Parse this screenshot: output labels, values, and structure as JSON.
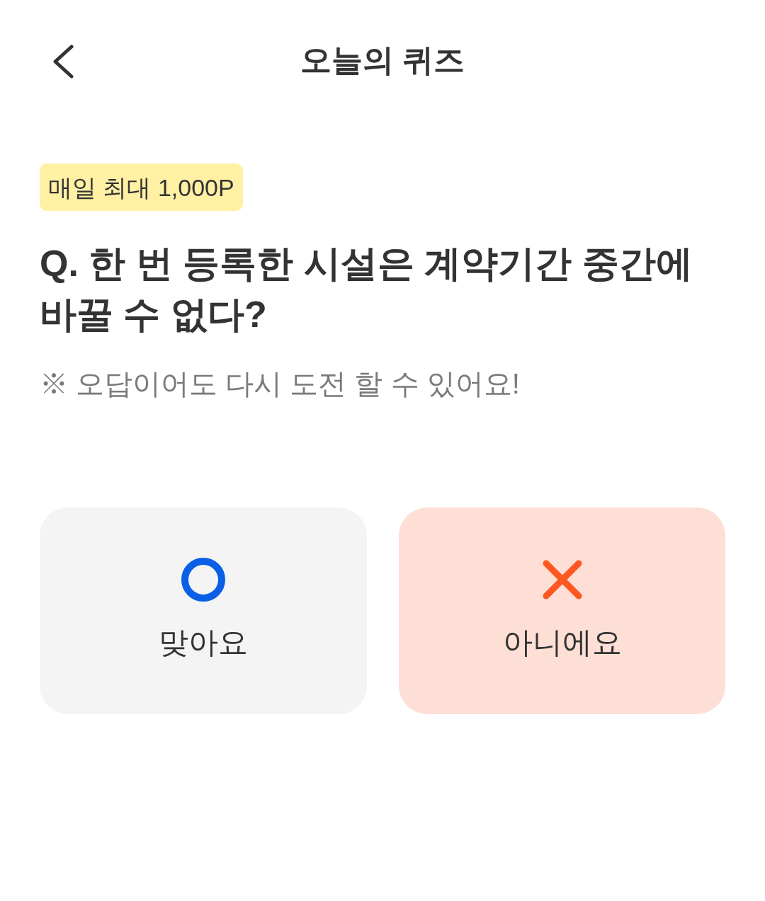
{
  "header": {
    "title": "오늘의 퀴즈"
  },
  "badge": "매일 최대 1,000P",
  "question": "Q. 한 번 등록한 시설은 계약기간 중간에 바꿀 수 없다?",
  "note": "※ 오답이어도 다시 도전 할 수 있어요!",
  "answers": [
    {
      "kind": "o",
      "label": "맞아요",
      "selected": false
    },
    {
      "kind": "x",
      "label": "아니에요",
      "selected": true
    }
  ]
}
